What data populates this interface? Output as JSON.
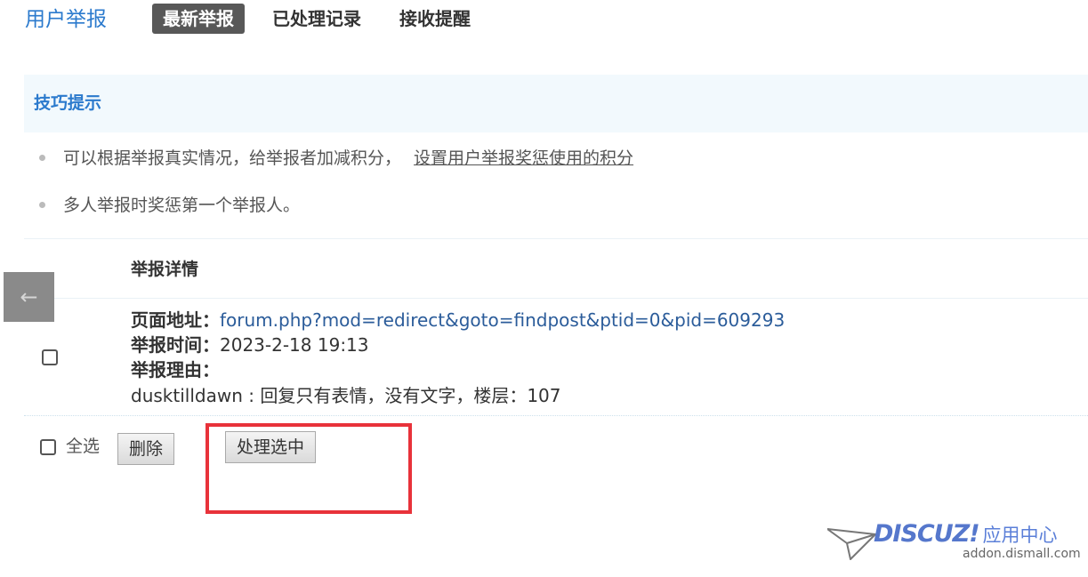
{
  "nav": {
    "title": "用户举报",
    "tabs": [
      {
        "label": "最新举报",
        "active": true
      },
      {
        "label": "已处理记录",
        "active": false
      },
      {
        "label": "接收提醒",
        "active": false
      }
    ]
  },
  "tips": {
    "title": "技巧提示",
    "items": [
      {
        "text": "可以根据举报真实情况，给举报者加减积分，",
        "link": "设置用户举报奖惩使用的积分"
      },
      {
        "text": "多人举报时奖惩第一个举报人。"
      }
    ]
  },
  "table": {
    "header": "举报详情",
    "rows": [
      {
        "page_label": "页面地址：",
        "page_url": "forum.php?mod=redirect&goto=findpost&ptid=0&pid=609293",
        "time_label": "举报时间：",
        "time_value": "2023-2-18 19:13",
        "reason_label": "举报理由：",
        "reporter": "dusktilldawn",
        "reason_sep": " : ",
        "reason_text": "回复只有表情，没有文字，楼层：",
        "floor": "107"
      }
    ]
  },
  "footer": {
    "select_all_label": "全选",
    "delete_label": "删除",
    "process_label": "处理选中"
  },
  "watermark": {
    "brand": "DISCUZ!",
    "brand_cn": "应用中心",
    "url": "addon.dismall.com"
  },
  "colors": {
    "accent": "#2b7acd",
    "active_tab_bg": "#585858",
    "highlight_box": "#e8323a"
  }
}
